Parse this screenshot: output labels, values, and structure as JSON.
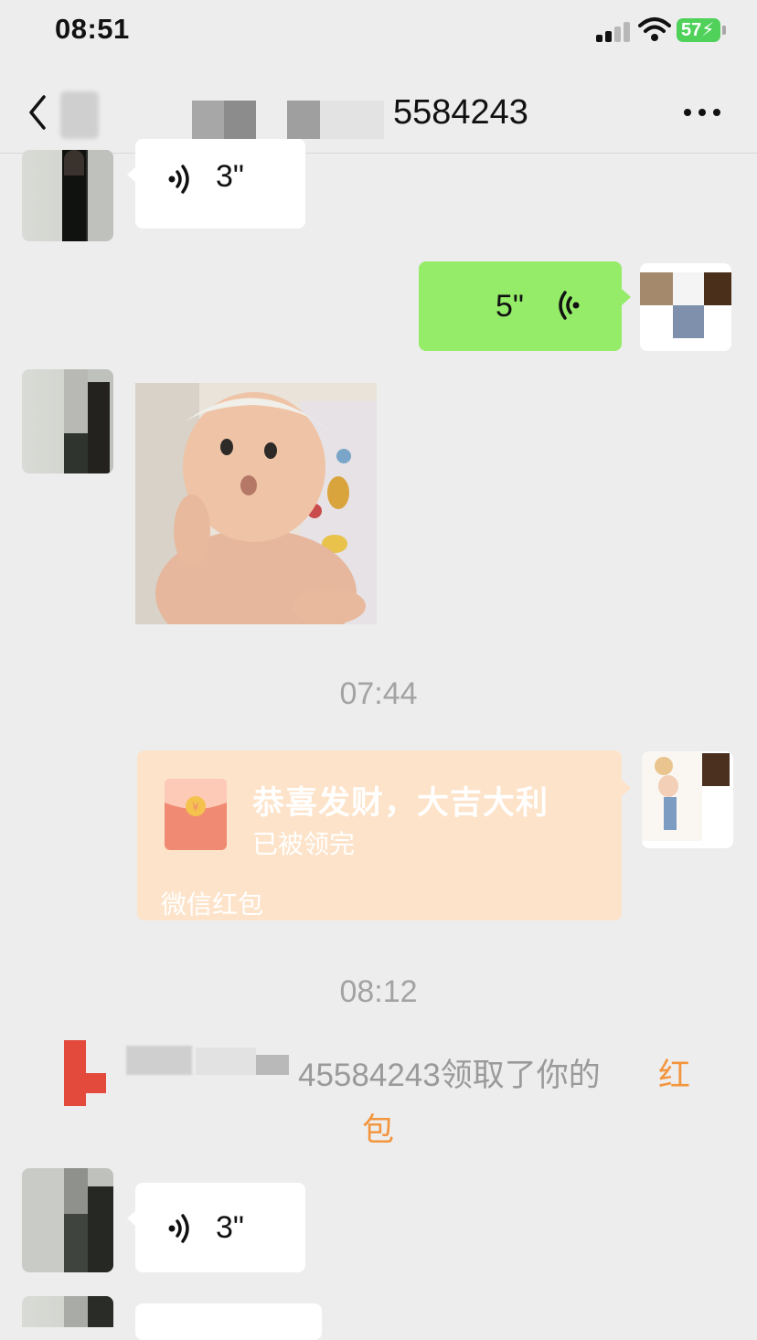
{
  "status_bar": {
    "time": "08:51",
    "battery": "57"
  },
  "nav": {
    "title_visible": "5584243",
    "icons": [
      "chevron-left-icon",
      "more-icon"
    ]
  },
  "messages": [
    {
      "type": "voice",
      "side": "left",
      "duration": "3\""
    },
    {
      "type": "voice",
      "side": "right",
      "duration": "5\""
    },
    {
      "type": "image",
      "side": "left"
    },
    {
      "type": "timestamp",
      "text": "07:44"
    },
    {
      "type": "red_packet",
      "side": "right",
      "title": "恭喜发财，大吉大利",
      "status": "已被领完",
      "footer": "微信红包"
    },
    {
      "type": "timestamp",
      "text": "08:12"
    },
    {
      "type": "system",
      "text_visible": "45584243领取了你的",
      "link_part1": "红",
      "link_part2": "包"
    },
    {
      "type": "voice",
      "side": "left",
      "duration": "3\""
    }
  ],
  "colors": {
    "background": "#ededed",
    "self_bubble": "#95ec69",
    "other_bubble": "#ffffff",
    "red_packet_bg": "#fde3c9",
    "system_link": "#f3953d",
    "timestamp_text": "#a3a3a3"
  }
}
